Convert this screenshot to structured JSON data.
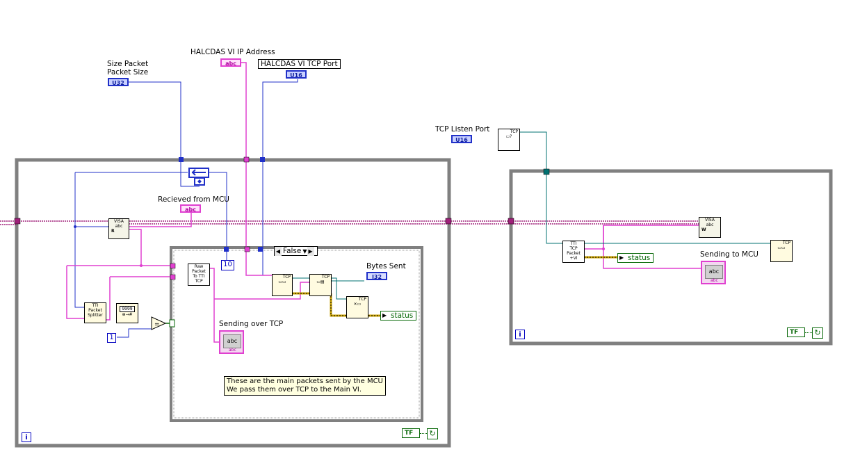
{
  "labels": {
    "size_packet_line1": "Size Packet",
    "size_packet_line2": "Packet Size",
    "ip_address": "HALCDAS VI IP Address",
    "tcp_port": "HALCDAS VI TCP Port",
    "tcp_listen_port": "TCP Listen Port",
    "received_from_mcu": "Recieved from MCU",
    "bytes_sent": "Bytes Sent",
    "sending_over_tcp": "Sending over TCP",
    "sending_to_mcu": "Sending to MCU"
  },
  "terminals": {
    "size_packet_type": "U32",
    "ip_address_type": "abc",
    "tcp_port_type": "U16",
    "listen_port_type": "U16",
    "received_type": "abc",
    "bytes_sent_type": "I32",
    "status_left": "status",
    "status_right": "status"
  },
  "nodes": {
    "visa_read": [
      "VISA",
      "abc",
      "R"
    ],
    "packet_splitter": [
      "TTI",
      "Packet",
      "Splitter"
    ],
    "format_node": [
      "9999"
    ],
    "raw_packet": [
      "Raw",
      "Packet",
      "To TTI",
      "TCP"
    ],
    "tti_tcp_packet": [
      "TTI",
      "TCP",
      "Packet",
      "+VI"
    ],
    "visa_write": [
      "VISA",
      "abc",
      "W"
    ],
    "tcp_open": [
      "TCP"
    ],
    "tcp_write": [
      "TCP"
    ],
    "tcp_close": [
      "TCP"
    ],
    "tcp_listen": [
      "TCP"
    ],
    "tcp_read_right": [
      "TCP"
    ]
  },
  "constants": {
    "ten": "10",
    "one": "1"
  },
  "case_structure": {
    "selector_value": "False",
    "left_arrow": "◀",
    "right_arrow": "▶"
  },
  "indicators": {
    "abc_left": "abc",
    "abc_left_sub": "abc",
    "abc_right": "abc",
    "abc_right_sub": "abc"
  },
  "note": {
    "line1": "These are the main packets sent by the MCU",
    "line2": "We pass them over TCP to the Main VI."
  },
  "loops": {
    "iteration_symbol": "i",
    "stop_symbol": "TF",
    "stop_icon_glyph": "↻"
  },
  "colors": {
    "loop_frame": "#808080",
    "string_wire": "#e040d0",
    "numeric_wire": "#2030c8",
    "tcp_ref_wire": "#007070",
    "error_wire": "#c8a000",
    "boolean": "#0a6a0a"
  }
}
